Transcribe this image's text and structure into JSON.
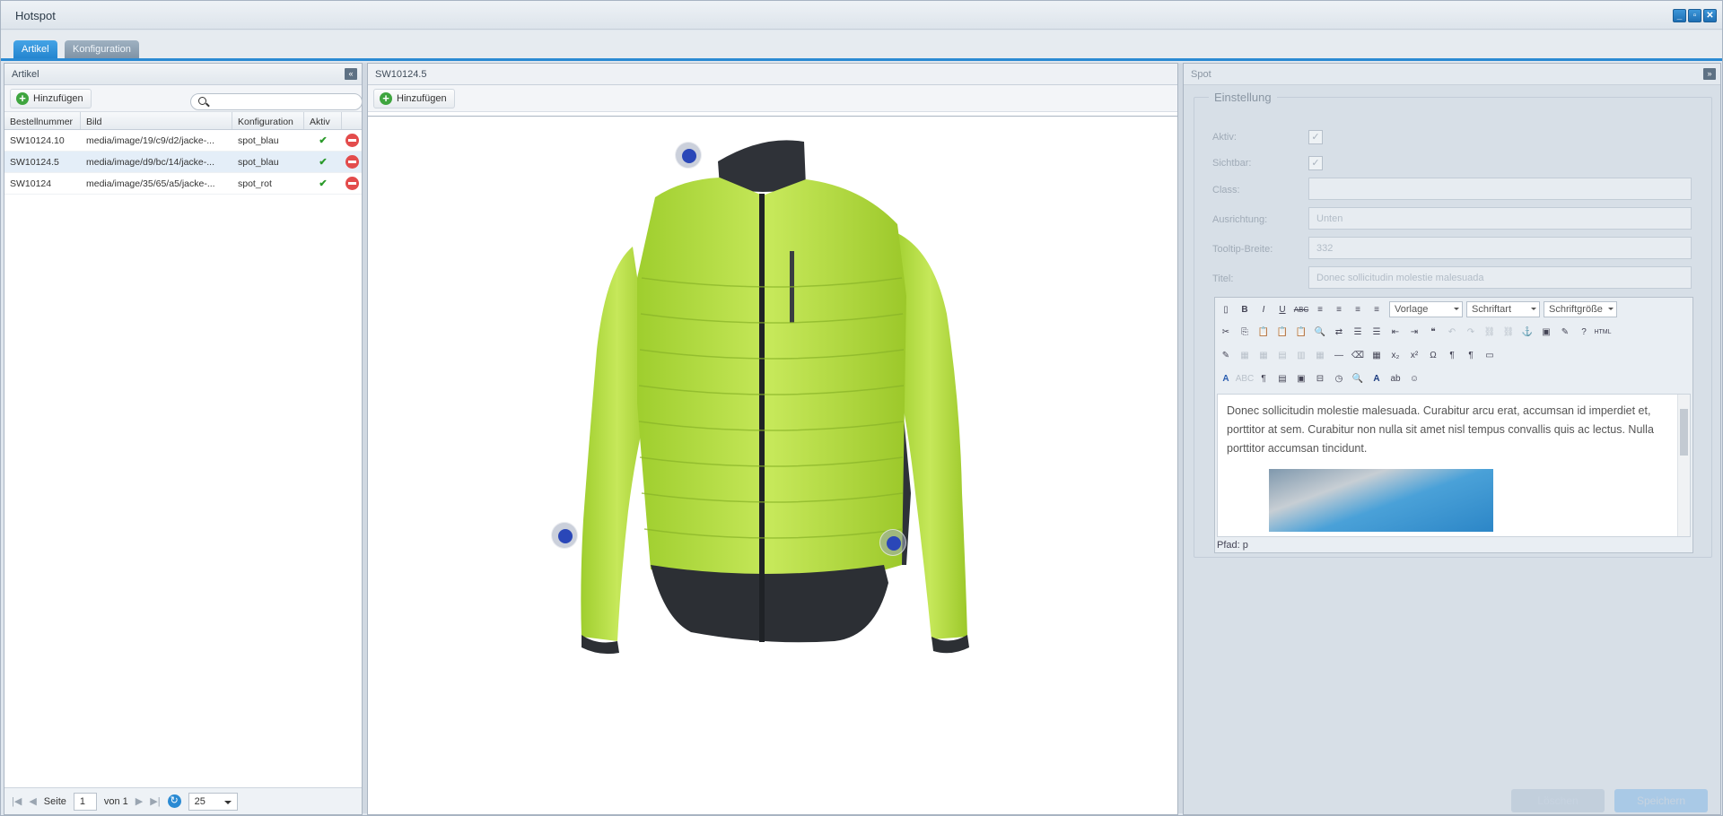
{
  "window": {
    "title": "Hotspot"
  },
  "tabs": [
    {
      "label": "Artikel"
    },
    {
      "label": "Konfiguration"
    }
  ],
  "left": {
    "title": "Artikel",
    "add_label": "Hinzufügen",
    "search_placeholder": "",
    "columns": [
      "Bestellnummer",
      "Bild",
      "Konfiguration",
      "Aktiv"
    ],
    "rows": [
      {
        "nr": "SW10124.10",
        "bild": "media/image/19/c9/d2/jacke-...",
        "konf": "spot_blau",
        "aktiv": "✔"
      },
      {
        "nr": "SW10124.5",
        "bild": "media/image/d9/bc/14/jacke-...",
        "konf": "spot_blau",
        "aktiv": "✔"
      },
      {
        "nr": "SW10124",
        "bild": "media/image/35/65/a5/jacke-...",
        "konf": "spot_rot",
        "aktiv": "✔"
      }
    ],
    "pager": {
      "seite_label": "Seite",
      "page": "1",
      "von_label": "von 1",
      "page_size": "25"
    }
  },
  "center": {
    "title": "SW10124.5",
    "add_label": "Hinzufügen"
  },
  "right": {
    "title": "Spot",
    "legend": "Einstellung",
    "fields": {
      "aktiv_label": "Aktiv:",
      "sichtbar_label": "Sichtbar:",
      "class_label": "Class:",
      "ausrichtung_label": "Ausrichtung:",
      "ausrichtung_value": "Unten",
      "tooltip_label": "Tooltip-Breite:",
      "tooltip_value": "332",
      "titel_label": "Titel:",
      "titel_value": "Donec sollicitudin molestie malesuada"
    },
    "editor": {
      "vorlage": "Vorlage",
      "schriftart": "Schriftart",
      "schriftgroesse": "Schriftgröße",
      "text": "Donec sollicitudin molestie malesuada. Curabitur arcu erat, accumsan id imperdiet et, porttitor at sem. Curabitur non nulla sit amet nisl tempus convallis quis ac lectus. Nulla porttitor accumsan tincidunt.",
      "path": "Pfad: p"
    },
    "delete_label": "Löschen",
    "save_label": "Speichern"
  }
}
